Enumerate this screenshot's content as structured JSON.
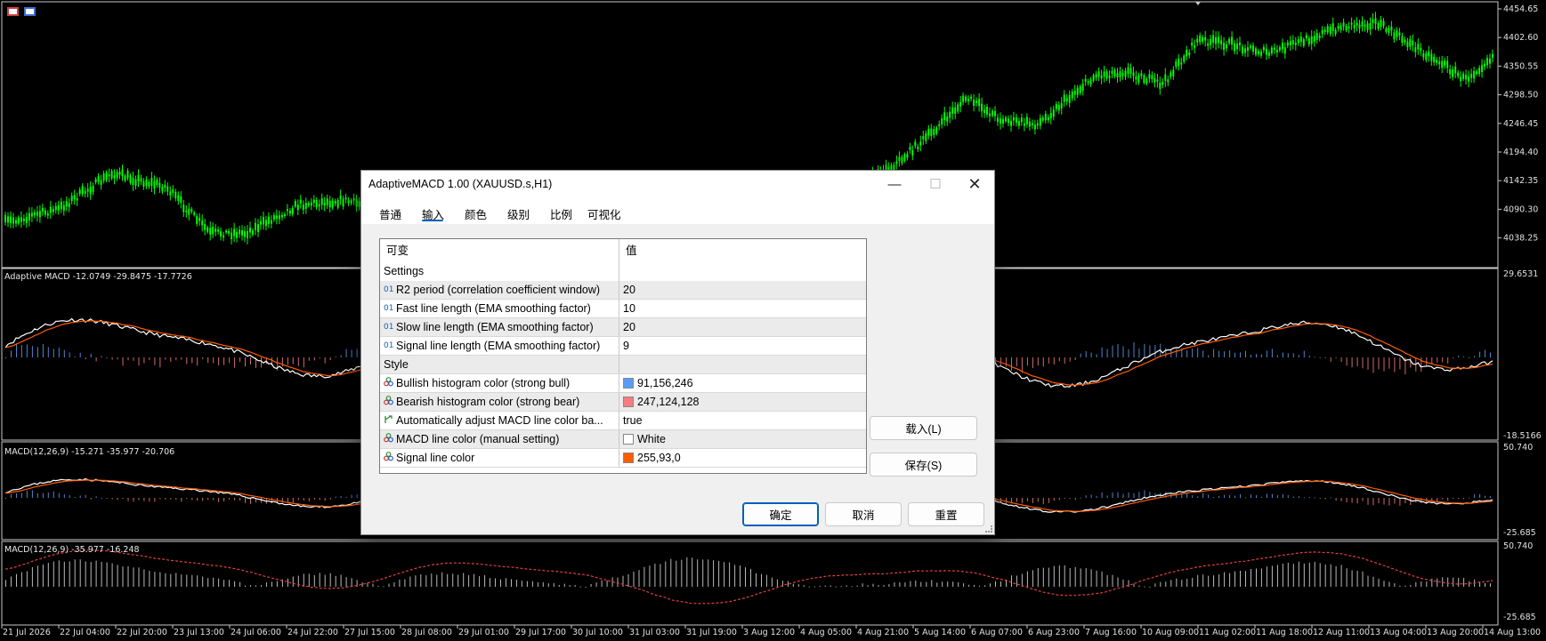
{
  "chart": {
    "price_labels": [
      "4454.65",
      "4402.60",
      "4350.55",
      "4298.50",
      "4246.45",
      "4194.40",
      "4142.35",
      "4090.30",
      "4038.25"
    ],
    "pane1": {
      "title": "Adaptive MACD -12.0749 -29.8475 -17.7726",
      "top_label": "29.6531",
      "bottom_label": "-18.5166"
    },
    "pane2": {
      "title": "MACD(12,26,9) -15.271 -35.977 -20.706",
      "top_label": "50.740",
      "bottom_label": "-25.685"
    },
    "pane3": {
      "title": "MACD(12,26,9) -35.977 -16.248",
      "top_label": "50.740",
      "bottom_label": "-25.685"
    },
    "time_labels": [
      "21 Jul 2026",
      "22 Jul 04:00",
      "22 Jul 20:00",
      "23 Jul 13:00",
      "24 Jul 06:00",
      "24 Jul 22:00",
      "27 Jul 15:00",
      "28 Jul 08:00",
      "29 Jul 01:00",
      "29 Jul 17:00",
      "30 Jul 10:00",
      "31 Jul 03:00",
      "31 Jul 19:00",
      "3 Aug 12:00",
      "4 Aug 05:00",
      "4 Aug 21:00",
      "5 Aug 14:00",
      "6 Aug 07:00",
      "6 Aug 23:00",
      "7 Aug 16:00",
      "10 Aug 09:00",
      "11 Aug 02:00",
      "11 Aug 18:00",
      "12 Aug 11:00",
      "13 Aug 04:00",
      "13 Aug 20:00",
      "14 Aug 13:00"
    ],
    "colors": {
      "bull_candle": "#00ff00",
      "macd_line": "#ffffff",
      "signal_line": "#ff5d00",
      "bull_hist": "#5b9cf6",
      "bear_hist": "#f77c80"
    }
  },
  "dialog": {
    "title": "AdaptiveMACD 1.00 (XAUUSD.s,H1)",
    "tabs": [
      "普通",
      "输入",
      "颜色",
      "级别",
      "比例",
      "可视化"
    ],
    "active_tab": "输入",
    "header": {
      "col1": "可变",
      "col2": "值"
    },
    "sections": {
      "settings": "Settings",
      "style": "Style"
    },
    "inputs": [
      {
        "type": "01",
        "name": "R2 period (correlation coefficient window)",
        "value": "20"
      },
      {
        "type": "01",
        "name": "Fast line length (EMA smoothing factor)",
        "value": "10"
      },
      {
        "type": "01",
        "name": "Slow line length (EMA smoothing factor)",
        "value": "20"
      },
      {
        "type": "01",
        "name": "Signal line length (EMA smoothing factor)",
        "value": "9"
      }
    ],
    "style": [
      {
        "icon": "color",
        "name": "Bullish histogram color (strong bull)",
        "value": "91,156,246",
        "swatch": "#5b9cf6"
      },
      {
        "icon": "color",
        "name": "Bearish histogram color (strong bear)",
        "value": "247,124,128",
        "swatch": "#f77c80"
      },
      {
        "icon": "bool",
        "name": "Automatically adjust MACD line color ba...",
        "value": "true",
        "swatch": ""
      },
      {
        "icon": "color",
        "name": "MACD line color (manual setting)",
        "value": "White",
        "swatch": "#ffffff"
      },
      {
        "icon": "color",
        "name": "Signal line color",
        "value": "255,93,0",
        "swatch": "#ff5d00"
      }
    ],
    "buttons": {
      "load": "载入(L)",
      "save": "保存(S)",
      "ok": "确定",
      "cancel": "取消",
      "reset": "重置"
    }
  }
}
